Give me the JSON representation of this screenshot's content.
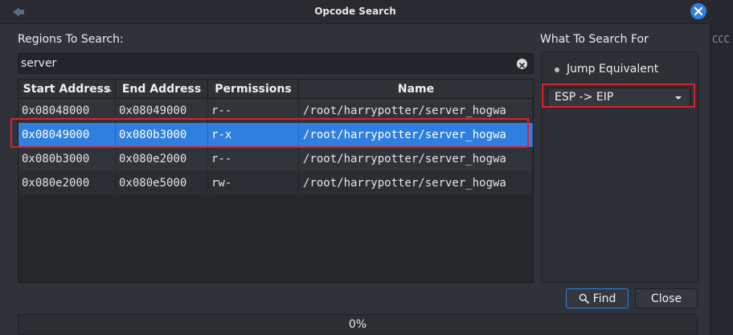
{
  "window": {
    "title": "Opcode Search"
  },
  "background": {
    "edge_text": "CCC"
  },
  "regions": {
    "heading": "Regions To Search:",
    "search_value": "server",
    "columns": [
      "Start Address",
      "End Address",
      "Permissions",
      "Name"
    ],
    "sorted_column": "Start Address",
    "rows": [
      {
        "start": "0x08048000",
        "end": "0x08049000",
        "perms": "r--",
        "name": "/root/harrypotter/server_hogwa"
      },
      {
        "start": "0x08049000",
        "end": "0x080b3000",
        "perms": "r-x",
        "name": "/root/harrypotter/server_hogwa",
        "selected": true
      },
      {
        "start": "0x080b3000",
        "end": "0x080e2000",
        "perms": "r--",
        "name": "/root/harrypotter/server_hogwa"
      },
      {
        "start": "0x080e2000",
        "end": "0x080e5000",
        "perms": "rw-",
        "name": "/root/harrypotter/server_hogwa"
      }
    ]
  },
  "search_for": {
    "heading": "What To Search For",
    "radio_label_mnemonic": "J",
    "radio_label_rest": "ump Equivalent",
    "dropdown_value": "ESP -> EIP"
  },
  "buttons": {
    "find_label": "Find",
    "close_label": "Close"
  },
  "progress": {
    "percent_value": 0,
    "label": "0%"
  },
  "colors": {
    "accent": "#2f7fe0",
    "highlight_red": "#e0202a"
  },
  "icons": {
    "app": "back-arrow-icon",
    "close": "close-icon",
    "clear": "clear-icon",
    "find": "search-icon",
    "sort": "sort-ascending-icon",
    "dropdown": "chevron-down-icon"
  }
}
